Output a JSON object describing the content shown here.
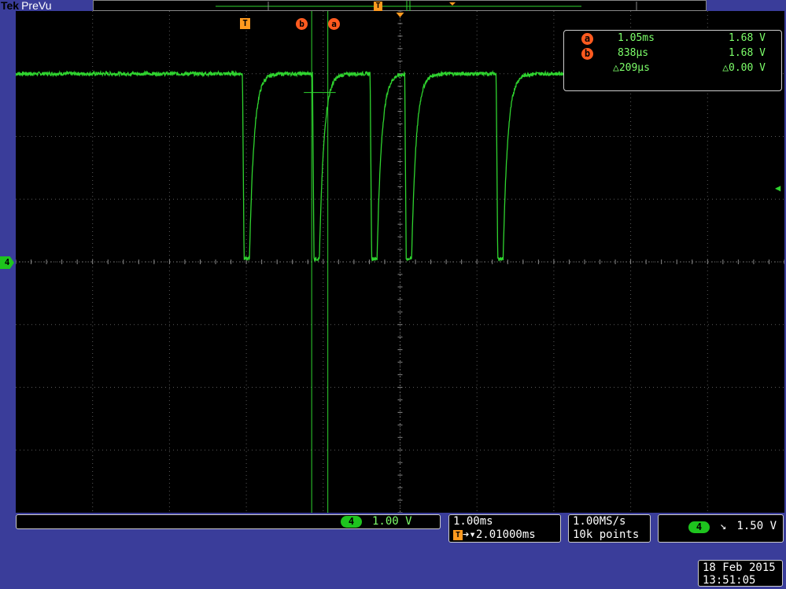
{
  "brand": {
    "vendor": "Tek",
    "mode": "PreVu"
  },
  "colors": {
    "background": "#3a3d9a",
    "trace": "#2fd42f",
    "readout_text": "#7dff6a",
    "cursor_badge": "#ff5a1f",
    "trigger_badge": "#ff9a1f"
  },
  "markers": {
    "trigger": "T",
    "cursor_a": "a",
    "cursor_b": "b",
    "channel": "4"
  },
  "cursors": {
    "a": {
      "label": "a",
      "time": "1.05ms",
      "volt": "1.68 V"
    },
    "b": {
      "label": "b",
      "time": "838µs",
      "volt": "1.68 V"
    },
    "delta": {
      "time": "△209µs",
      "volt": "△0.00 V"
    }
  },
  "channel": {
    "number": "4",
    "scale": "1.00 V"
  },
  "horizontal": {
    "scale": "1.00ms",
    "trigger_marker": "T",
    "position": "➔▾2.01000ms"
  },
  "acquisition": {
    "rate": "1.00MS/s",
    "record": "10k points"
  },
  "trigger": {
    "source": "4",
    "slope": "↘",
    "level": "1.50 V"
  },
  "timestamp": {
    "date": "18 Feb  2015",
    "time": "13:51:05"
  },
  "waveform": {
    "divisions": {
      "x": 10,
      "y": 8
    },
    "volts_per_div": 1.0,
    "high_level_div": 3.0,
    "low_level_div": 0.05,
    "pulses_ms": [
      {
        "fall": 2.95,
        "rise": 3.04
      },
      {
        "fall": 3.86,
        "rise": 3.95
      },
      {
        "fall": 4.61,
        "rise": 4.7
      },
      {
        "fall": 5.06,
        "rise": 5.15
      },
      {
        "fall": 6.25,
        "rise": 6.34
      }
    ],
    "trace_end_ms": 8.5,
    "cursor_a_ms": 4.06,
    "cursor_b_ms": 3.85,
    "trigger_ms": 2.95
  }
}
